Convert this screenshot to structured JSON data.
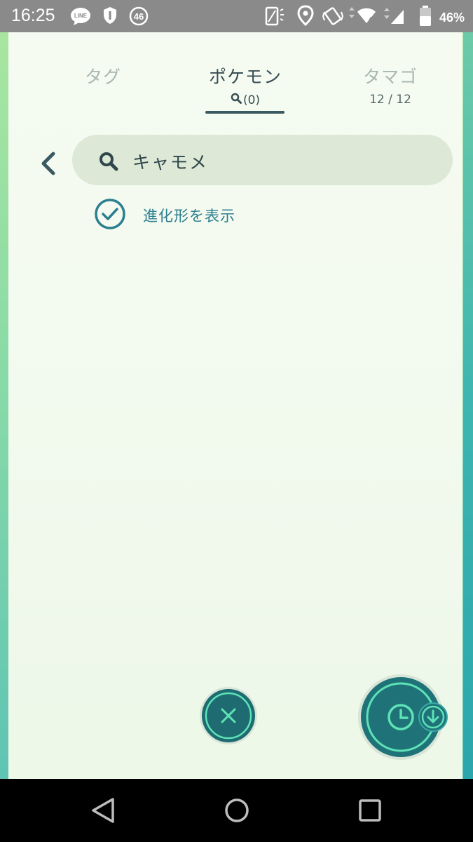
{
  "status_bar": {
    "time": "16:25",
    "line_badge": "LINE",
    "notification_count": "46",
    "network_label": "4",
    "battery_percent": "46%",
    "icons": [
      "line-icon",
      "shield-icon",
      "badge-46-icon",
      "vibrate-signal-icon",
      "location-pin-icon",
      "vibrate-icon",
      "wifi-icon",
      "cell-signal-icon",
      "battery-icon"
    ]
  },
  "tabs": [
    {
      "label": "タグ",
      "sub": "",
      "active": false
    },
    {
      "label": "ポケモン",
      "sub": "(0)",
      "active": true
    },
    {
      "label": "タマゴ",
      "sub": "12 / 12",
      "active": false
    }
  ],
  "search": {
    "value": "キャモメ"
  },
  "evolution_checkbox": {
    "label": "進化形を表示",
    "checked": true
  },
  "colors": {
    "accent_teal": "#2c7f8f",
    "button_dark": "#1e7278",
    "button_ring": "#5ee2b6",
    "panel_bg": "#f3faf0",
    "search_bg": "#dde9d6"
  }
}
